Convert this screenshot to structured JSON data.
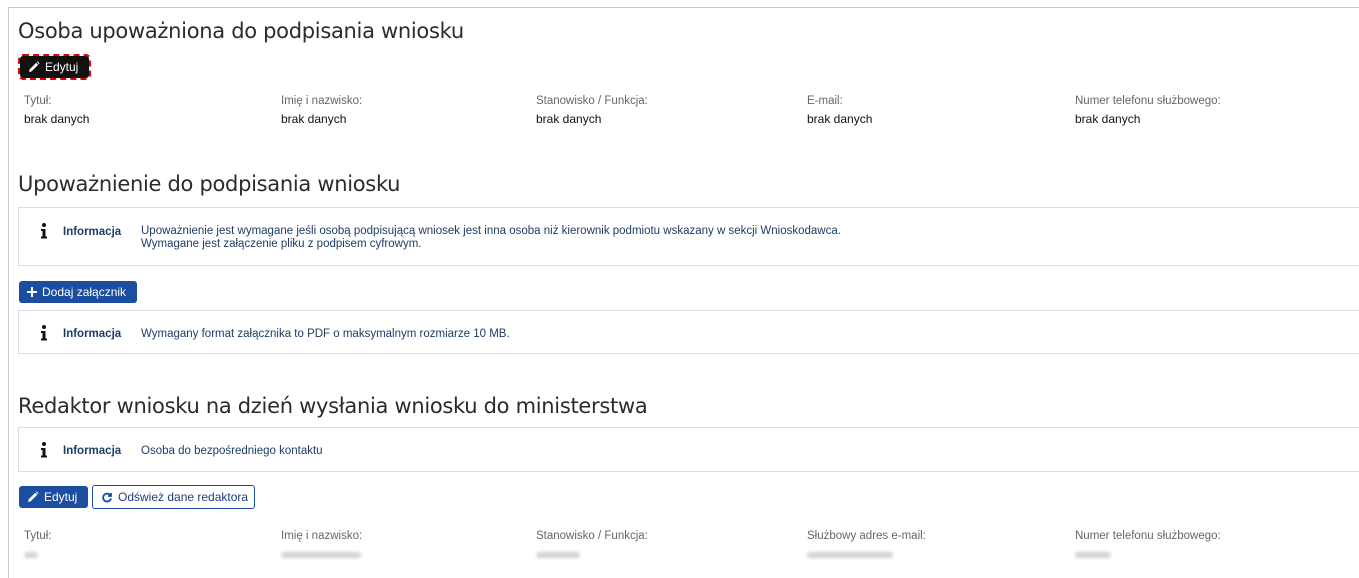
{
  "section1": {
    "title": "Osoba upoważniona do podpisania wniosku",
    "edit_label": "Edytuj",
    "fields": [
      {
        "label": "Tytuł:",
        "value": "brak danych"
      },
      {
        "label": "Imię i nazwisko:",
        "value": "brak danych"
      },
      {
        "label": "Stanowisko / Funkcja:",
        "value": "brak danych"
      },
      {
        "label": "E-mail:",
        "value": "brak danych"
      },
      {
        "label": "Numer telefonu służbowego:",
        "value": "brak danych"
      }
    ]
  },
  "section2": {
    "title": "Upoważnienie do podpisania wniosku",
    "info1": {
      "label": "Informacja",
      "line1": "Upoważnienie jest wymagane jeśli osobą podpisującą wniosek jest inna osoba niż kierownik podmiotu wskazany w sekcji Wnioskodawca.",
      "line2": "Wymagane jest załączenie pliku z podpisem cyfrowym."
    },
    "add_attachment_label": "Dodaj załącznik",
    "info2": {
      "label": "Informacja",
      "text": "Wymagany format załącznika to PDF o maksymalnym rozmiarze 10 MB."
    }
  },
  "section3": {
    "title": "Redaktor wniosku na dzień wysłania wniosku do ministerstwa",
    "info": {
      "label": "Informacja",
      "text": "Osoba do bezpośredniego kontaktu"
    },
    "edit_label": "Edytuj",
    "refresh_label": "Odśwież dane redaktora",
    "fields": [
      {
        "label": "Tytuł:"
      },
      {
        "label": "Imię i nazwisko:"
      },
      {
        "label": "Stanowisko / Funkcja:"
      },
      {
        "label": "Służbowy adres e-mail:"
      },
      {
        "label": "Numer telefonu służbowego:"
      }
    ]
  },
  "colors": {
    "primary_button": "#1b4ea0",
    "highlighted_button": "#111111",
    "info_text": "#1f3c66",
    "focus_outline": "#e00000"
  }
}
